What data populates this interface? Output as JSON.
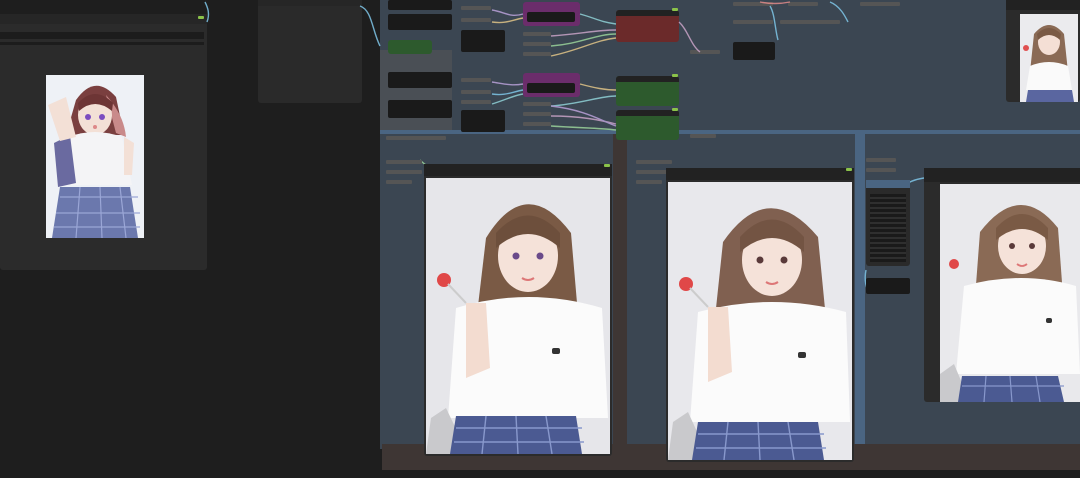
{
  "canvas": {
    "background": "#1e1e1e",
    "group_blue": "#3b4652",
    "group_border": "#4a6582",
    "group_brown": "#3e3634"
  },
  "nodes": {
    "load_image": {
      "title": "",
      "image_kind": "anime illustration"
    },
    "preview_top_right": {
      "title": ""
    },
    "preview_1": {
      "title": ""
    },
    "preview_2": {
      "title": ""
    },
    "preview_3": {
      "title": ""
    }
  },
  "node_colors": {
    "purple": "#6b2d6b",
    "red": "#6b2a2a",
    "green": "#2d5a2d",
    "default": "#353535"
  },
  "wire_colors": [
    "#8fd1d6",
    "#b9a1d9",
    "#e0c487",
    "#7fc6e8",
    "#c9a3c7",
    "#9ad29a"
  ],
  "icons": [
    "status-dot-icon",
    "image-thumbnail-icon",
    "photo-icon"
  ]
}
